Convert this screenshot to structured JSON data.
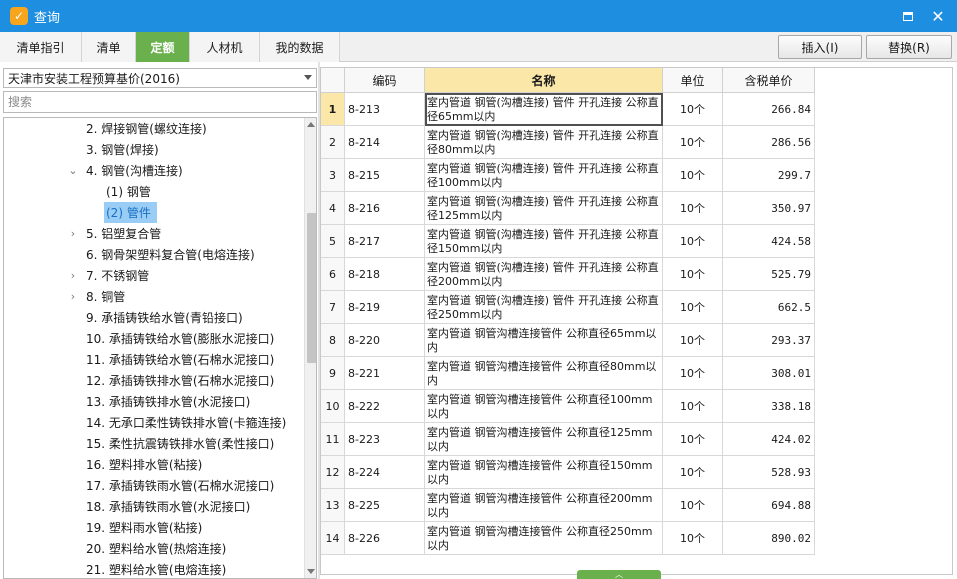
{
  "window": {
    "title": "查询",
    "app_icon": "app-logo-icon",
    "controls": [
      "maximize-icon",
      "close-icon"
    ]
  },
  "tabs": [
    {
      "label": "清单指引",
      "active": false
    },
    {
      "label": "清单",
      "active": false
    },
    {
      "label": "定额",
      "active": true
    },
    {
      "label": "人材机",
      "active": false
    },
    {
      "label": "我的数据",
      "active": false
    }
  ],
  "actions": {
    "insert_label": "插入(I)",
    "replace_label": "替换(R)"
  },
  "library": {
    "selected": "天津市安装工程预算基价(2016)"
  },
  "search": {
    "placeholder": "搜索",
    "value": ""
  },
  "tree": [
    {
      "label": "2. 焊接钢管(螺纹连接)",
      "level": 1,
      "expander": "none",
      "selected": false
    },
    {
      "label": "3. 钢管(焊接)",
      "level": 1,
      "expander": "none",
      "selected": false
    },
    {
      "label": "4. 钢管(沟槽连接)",
      "level": 1,
      "expander": "expanded",
      "selected": false
    },
    {
      "label": "(1) 钢管",
      "level": 2,
      "expander": "none",
      "selected": false
    },
    {
      "label": "(2) 管件",
      "level": 2,
      "expander": "none",
      "selected": true
    },
    {
      "label": "5. 铝塑复合管",
      "level": 1,
      "expander": "collapsed",
      "selected": false
    },
    {
      "label": "6. 钢骨架塑料复合管(电熔连接)",
      "level": 1,
      "expander": "none",
      "selected": false
    },
    {
      "label": "7. 不锈钢管",
      "level": 1,
      "expander": "collapsed",
      "selected": false
    },
    {
      "label": "8. 铜管",
      "level": 1,
      "expander": "collapsed",
      "selected": false
    },
    {
      "label": "9. 承插铸铁给水管(青铅接口)",
      "level": 1,
      "expander": "none",
      "selected": false
    },
    {
      "label": "10. 承插铸铁给水管(膨胀水泥接口)",
      "level": 1,
      "expander": "none",
      "selected": false
    },
    {
      "label": "11. 承插铸铁给水管(石棉水泥接口)",
      "level": 1,
      "expander": "none",
      "selected": false
    },
    {
      "label": "12. 承插铸铁排水管(石棉水泥接口)",
      "level": 1,
      "expander": "none",
      "selected": false
    },
    {
      "label": "13. 承插铸铁排水管(水泥接口)",
      "level": 1,
      "expander": "none",
      "selected": false
    },
    {
      "label": "14. 无承口柔性铸铁排水管(卡箍连接)",
      "level": 1,
      "expander": "none",
      "selected": false
    },
    {
      "label": "15. 柔性抗震铸铁排水管(柔性接口)",
      "level": 1,
      "expander": "none",
      "selected": false
    },
    {
      "label": "16. 塑料排水管(粘接)",
      "level": 1,
      "expander": "none",
      "selected": false
    },
    {
      "label": "17. 承插铸铁雨水管(石棉水泥接口)",
      "level": 1,
      "expander": "none",
      "selected": false
    },
    {
      "label": "18. 承插铸铁雨水管(水泥接口)",
      "level": 1,
      "expander": "none",
      "selected": false
    },
    {
      "label": "19. 塑料雨水管(粘接)",
      "level": 1,
      "expander": "none",
      "selected": false
    },
    {
      "label": "20. 塑料给水管(热熔连接)",
      "level": 1,
      "expander": "none",
      "selected": false
    },
    {
      "label": "21. 塑料给水管(电熔连接)",
      "level": 1,
      "expander": "none",
      "selected": false
    }
  ],
  "table": {
    "headers": {
      "code": "编码",
      "name": "名称",
      "unit": "单位",
      "price": "含税单价"
    },
    "rows": [
      {
        "no": "1",
        "code": "8-213",
        "name": "室内管道 钢管(沟槽连接) 管件 开孔连接 公称直径65mm以内",
        "unit": "10个",
        "price": "266.84"
      },
      {
        "no": "2",
        "code": "8-214",
        "name": "室内管道 钢管(沟槽连接) 管件 开孔连接 公称直径80mm以内",
        "unit": "10个",
        "price": "286.56"
      },
      {
        "no": "3",
        "code": "8-215",
        "name": "室内管道 钢管(沟槽连接) 管件 开孔连接 公称直径100mm以内",
        "unit": "10个",
        "price": "299.7"
      },
      {
        "no": "4",
        "code": "8-216",
        "name": "室内管道 钢管(沟槽连接) 管件 开孔连接 公称直径125mm以内",
        "unit": "10个",
        "price": "350.97"
      },
      {
        "no": "5",
        "code": "8-217",
        "name": "室内管道 钢管(沟槽连接) 管件 开孔连接 公称直径150mm以内",
        "unit": "10个",
        "price": "424.58"
      },
      {
        "no": "6",
        "code": "8-218",
        "name": "室内管道 钢管(沟槽连接) 管件 开孔连接 公称直径200mm以内",
        "unit": "10个",
        "price": "525.79"
      },
      {
        "no": "7",
        "code": "8-219",
        "name": "室内管道 钢管(沟槽连接) 管件 开孔连接 公称直径250mm以内",
        "unit": "10个",
        "price": "662.5"
      },
      {
        "no": "8",
        "code": "8-220",
        "name": "室内管道 钢管沟槽连接管件 公称直径65mm以内",
        "unit": "10个",
        "price": "293.37"
      },
      {
        "no": "9",
        "code": "8-221",
        "name": "室内管道 钢管沟槽连接管件 公称直径80mm以内",
        "unit": "10个",
        "price": "308.01"
      },
      {
        "no": "10",
        "code": "8-222",
        "name": "室内管道 钢管沟槽连接管件 公称直径100mm以内",
        "unit": "10个",
        "price": "338.18"
      },
      {
        "no": "11",
        "code": "8-223",
        "name": "室内管道 钢管沟槽连接管件 公称直径125mm以内",
        "unit": "10个",
        "price": "424.02"
      },
      {
        "no": "12",
        "code": "8-224",
        "name": "室内管道 钢管沟槽连接管件 公称直径150mm以内",
        "unit": "10个",
        "price": "528.93"
      },
      {
        "no": "13",
        "code": "8-225",
        "name": "室内管道 钢管沟槽连接管件 公称直径200mm以内",
        "unit": "10个",
        "price": "694.88"
      },
      {
        "no": "14",
        "code": "8-226",
        "name": "室内管道 钢管沟槽连接管件 公称直径250mm以内",
        "unit": "10个",
        "price": "890.02"
      }
    ]
  },
  "colors": {
    "titlebar": "#1e8fe0",
    "active_tab": "#6ab04c",
    "selection": "#99cdf5",
    "header_highlight": "#fbe8a8"
  }
}
